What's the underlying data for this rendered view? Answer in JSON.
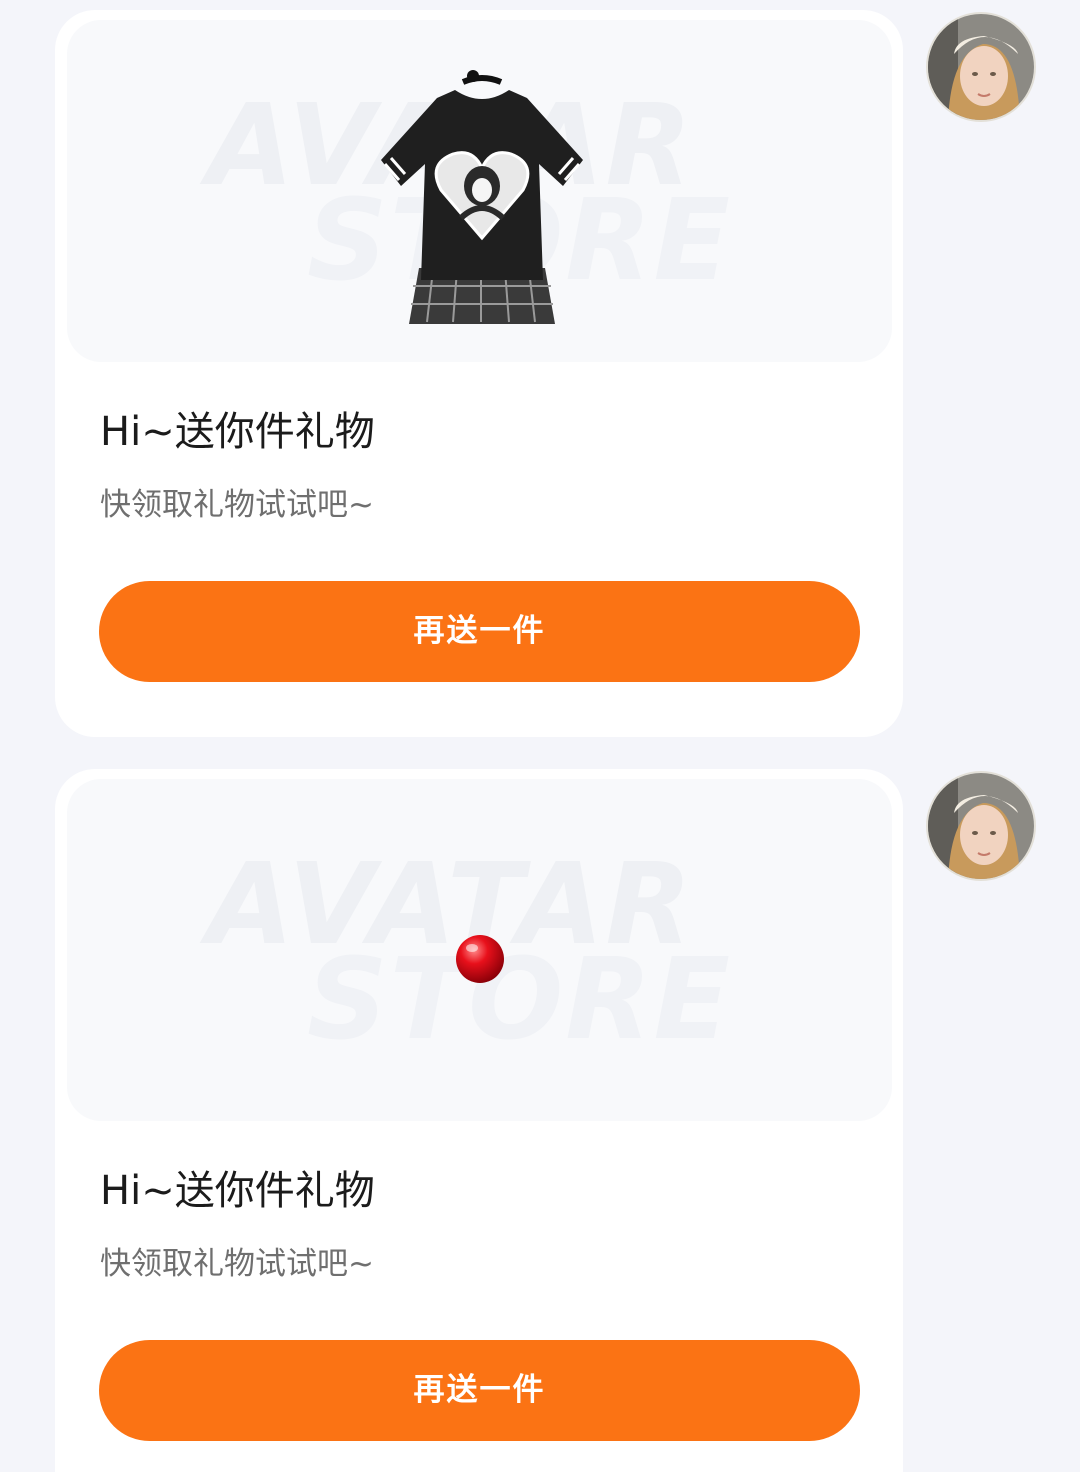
{
  "messages": [
    {
      "gift": "shirt-dress",
      "watermark": [
        "AVATAR",
        "STORE"
      ],
      "title": "Hi~送你件礼物",
      "subtitle": "快领取礼物试试吧~",
      "button_label": "再送一件"
    },
    {
      "gift": "red-ball",
      "watermark": [
        "AVATAR",
        "STORE"
      ],
      "title": "Hi~送你件礼物",
      "subtitle": "快领取礼物试试吧~",
      "button_label": "再送一件"
    }
  ],
  "colors": {
    "accent": "#fb7314",
    "background": "#f4f5fa",
    "card": "#ffffff"
  }
}
